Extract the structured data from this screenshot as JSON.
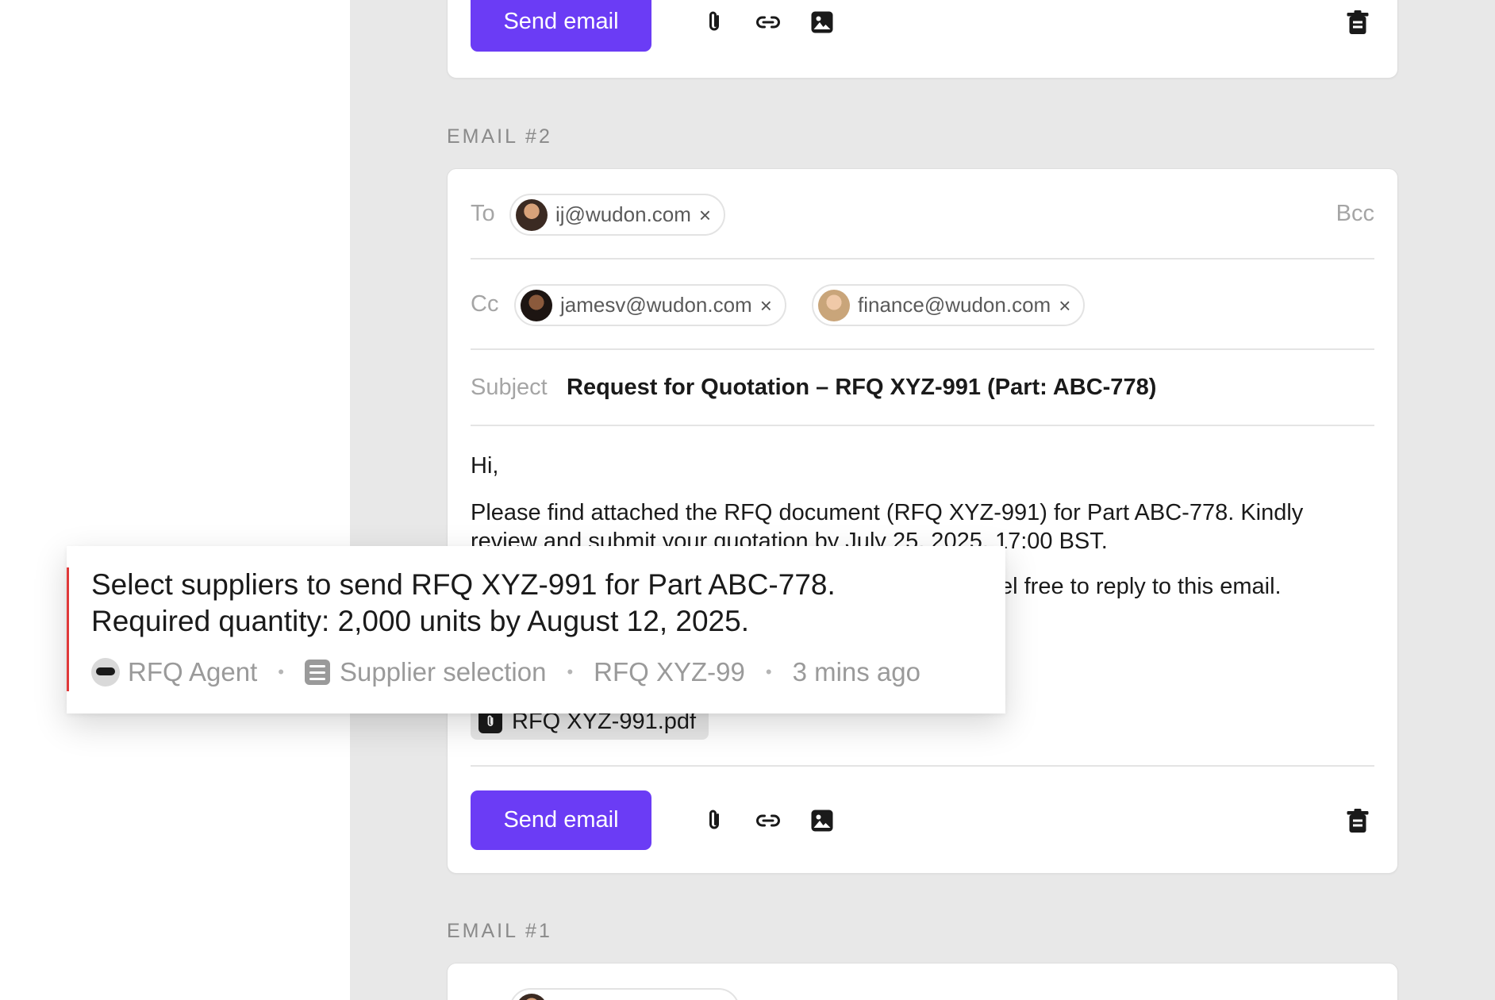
{
  "top_card": {
    "send_label": "Send email"
  },
  "email2": {
    "section_label": "EMAIL #2",
    "to_label": "To",
    "to_recipients": [
      "ij@wudon.com"
    ],
    "bcc_label": "Bcc",
    "cc_label": "Cc",
    "cc_recipients": [
      "jamesv@wudon.com",
      "finance@wudon.com"
    ],
    "subject_label": "Subject",
    "subject_value": "Request for Quotation – RFQ XYZ-991 (Part: ABC-778)",
    "body": {
      "greeting": "Hi,",
      "paragraph1_line1": "Please find attached the RFQ document (RFQ XYZ-991) for Part ABC-778. Kindly",
      "paragraph1_line2": "review and submit your quotation by July 25, 2025, 17:00 BST.",
      "paragraph2_partial": "el free to reply to this email."
    },
    "attachment_name": "RFQ XYZ-991.pdf",
    "send_label": "Send email"
  },
  "email1": {
    "section_label": "EMAIL #1"
  },
  "popup": {
    "message_line1": "Select suppliers to send RFQ XYZ-991 for Part ABC-778.",
    "message_line2": "Required quantity: 2,000 units by August 12, 2025.",
    "agent": "RFQ Agent",
    "step": "Supplier selection",
    "reference": "RFQ XYZ-99",
    "time": "3 mins ago",
    "separator": "•"
  },
  "icons": [
    "paperclip-icon",
    "link-icon",
    "image-icon",
    "trash-icon",
    "close-icon",
    "pdf-icon",
    "agent-icon",
    "checklist-icon"
  ],
  "colors": {
    "accent": "#6b3cf5",
    "popup_accent": "#e0393a",
    "background": "#e8e8e8"
  }
}
